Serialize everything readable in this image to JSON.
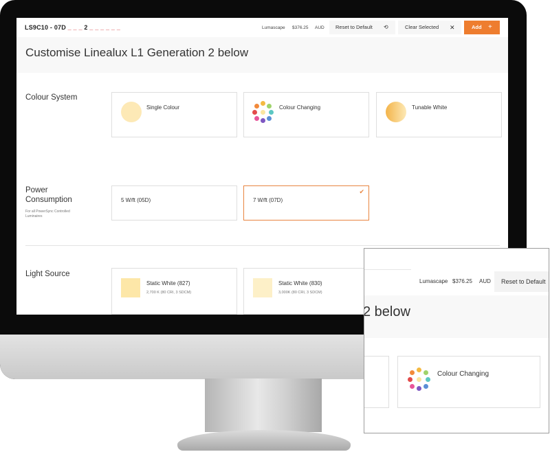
{
  "topbar": {
    "sku_prefix": "LS9C10 - 07D",
    "sku_blanks_1": "_ _ _",
    "sku_digit": "2",
    "sku_blanks_2": "_ _ _ _ _ _",
    "brand": "Lumascape",
    "price": "$376.25",
    "currency": "AUD",
    "reset_label": "Reset to Default",
    "reset_icon": "undo-icon",
    "clear_label": "Clear Selected",
    "clear_icon": "close-icon",
    "add_label": "Add",
    "add_icon": "plus-icon"
  },
  "page": {
    "title": "Customise Linealux L1 Generation 2 below"
  },
  "sections": {
    "colour_system": {
      "label": "Colour System",
      "options": [
        {
          "name": "Single Colour",
          "icon": "single-colour-icon",
          "color": "#fde9b6"
        },
        {
          "name": "Colour Changing",
          "icon": "colour-wheel-icon"
        },
        {
          "name": "Tunable White",
          "icon": "tunable-white-icon",
          "color": "#f5c46a"
        }
      ]
    },
    "power": {
      "label_line1": "Power",
      "label_line2": "Consumption",
      "note_line1": "For all PowerSync Controlled",
      "note_line2": "Luminaires",
      "options": [
        {
          "name": "5 W/ft (05D)",
          "selected": false
        },
        {
          "name": "7 W/ft (07D)",
          "selected": true
        }
      ]
    },
    "light_source": {
      "label": "Light Source",
      "options": [
        {
          "name": "Static White (827)",
          "detail": "2,700 K (80 CRI, 3 SDCM)",
          "color": "#fde7a8"
        },
        {
          "name": "Static White (830)",
          "detail": "3,000K (80 CRI, 3 SDCM)",
          "color": "#fdf0c8"
        }
      ]
    }
  },
  "zoom": {
    "brand": "Lumascape",
    "price": "$376.25",
    "currency": "AUD",
    "reset_label": "Reset to Default",
    "title_fragment": "2 below",
    "card_name": "Colour Changing"
  },
  "colors": {
    "accent": "#ee7d2f",
    "sku_red": "#d0232a",
    "wheel": [
      "#f4b942",
      "#9fd36b",
      "#5cc7c3",
      "#5b8fd6",
      "#7e57c2",
      "#e8559b",
      "#e34b4b",
      "#f28a3b",
      "#fbe6a0"
    ]
  }
}
